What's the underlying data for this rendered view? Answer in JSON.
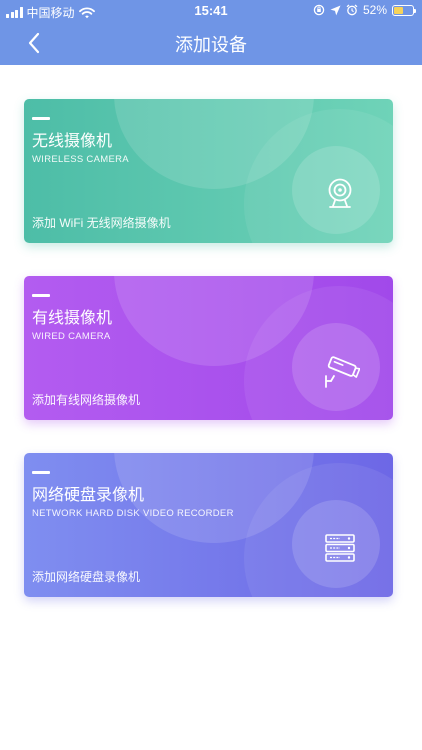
{
  "status_bar": {
    "carrier": "中国移动",
    "time": "15:41",
    "battery": "52%",
    "battery_level": 0.52,
    "battery_color": "#f6d35b"
  },
  "nav": {
    "title": "添加设备",
    "header_color": "#6f95e6"
  },
  "cards": [
    {
      "title": "无线摄像机",
      "subtitle": "WIRELESS CAMERA",
      "description": "添加 WiFi 无线网络摄像机",
      "icon": "webcam-icon",
      "colors": [
        "#4dbda7",
        "#6fd3b8"
      ]
    },
    {
      "title": "有线摄像机",
      "subtitle": "WIRED CAMERA",
      "description": "添加有线网络摄像机",
      "icon": "cctv-camera-icon",
      "colors": [
        "#b35cf0",
        "#a149ea"
      ]
    },
    {
      "title": "网络硬盘录像机",
      "subtitle": "NETWORK HARD DISK VIDEO RECORDER",
      "description": "添加网络硬盘录像机",
      "icon": "server-rack-icon",
      "colors": [
        "#7f8ef0",
        "#6d67e6"
      ]
    }
  ]
}
